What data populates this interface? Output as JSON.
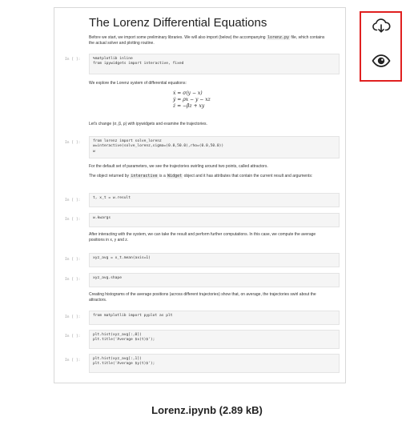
{
  "notebook": {
    "title": "The Lorenz Differential Equations",
    "prompt_label": "In [ ]:",
    "intro": {
      "before": "Before we start, we import some preliminary libraries. We will also import (below) the accompanying",
      "code": "lorenz.py",
      "after": "file, which contains the actual solver and plotting routine."
    },
    "cell1": [
      "%matplotlib inline",
      "from ipywidgets import interactive, fixed"
    ],
    "explore_text": "We explore the Lorenz system of differential equations:",
    "equations": [
      "ẋ = σ(y − x)",
      "ẏ = ρx − y − xz",
      "ż = −βz + xy"
    ],
    "change_text": "Let's change (σ, β, ρ) with ipywidgets and examine the trajectories.",
    "cell2": [
      "from lorenz import solve_lorenz",
      "w=interactive(solve_lorenz,sigma=(0.0,50.0),rho=(0.0,50.0))",
      "w"
    ],
    "default_text": "For the default set of parameters, we see the trajectories swirling around two points, called attractors.",
    "object_text": {
      "before": "The object returned by",
      "code1": "interactive",
      "middle": "is a",
      "code2": "Widget",
      "after": "object and it has attributes that contain the current result and arguments:"
    },
    "cell3": [
      "t, x_t = w.result"
    ],
    "cell4": [
      "w.kwargs"
    ],
    "after_text": "After interacting with the system, we can take the result and perform further computations. In this case, we compute the average positions in x, y and z.",
    "cell5": [
      "xyz_avg = x_t.mean(axis=1)"
    ],
    "cell6": [
      "xyz_avg.shape"
    ],
    "hist_text": "Creating histograms of the average positions (across different trajectories) show that, on average, the trajectories swirl about the attractors.",
    "cell7": [
      "from matplotlib import pyplot as plt"
    ],
    "cell8": [
      "plt.hist(xyz_avg[:,0])",
      "plt.title('Average $x(t)$');"
    ],
    "cell9": [
      "plt.hist(xyz_avg[:,1])",
      "plt.title('Average $y(t)$');"
    ]
  },
  "actions": {
    "download_icon": "cloud-download-icon",
    "preview_icon": "eye-icon",
    "highlight_color": "#e02020"
  },
  "file": {
    "caption": "Lorenz.ipynb (2.89 kB)"
  }
}
